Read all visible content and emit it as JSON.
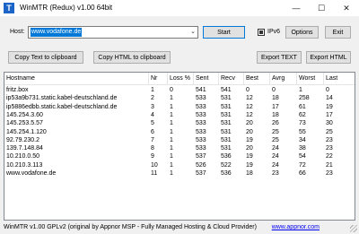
{
  "window": {
    "title": "WinMTR (Redux) v1.00 64bit",
    "icon": "winmtr-app-icon",
    "minimize": "—",
    "maximize": "☐",
    "close": "✕"
  },
  "host": {
    "label": "Host:",
    "value": "www.vodafone.de",
    "ipv6_label": "IPv6",
    "ipv6_checked": true
  },
  "buttons": {
    "start": "Start",
    "options": "Options",
    "exit": "Exit",
    "copy_text": "Copy Text to clipboard",
    "copy_html": "Copy HTML to clipboard",
    "export_text": "Export TEXT",
    "export_html": "Export HTML"
  },
  "table": {
    "headers": [
      "Hostname",
      "Nr",
      "Loss %",
      "Sent",
      "Recv",
      "Best",
      "Avrg",
      "Worst",
      "Last"
    ],
    "rows": [
      [
        "fritz.box",
        "1",
        "0",
        "541",
        "541",
        "0",
        "0",
        "1",
        "0"
      ],
      [
        "ip53a9b731.static.kabel-deutschland.de",
        "2",
        "1",
        "533",
        "531",
        "12",
        "18",
        "258",
        "14"
      ],
      [
        "ip5886edbb.static.kabel-deutschland.de",
        "3",
        "1",
        "533",
        "531",
        "12",
        "17",
        "61",
        "19"
      ],
      [
        "145.254.3.60",
        "4",
        "1",
        "533",
        "531",
        "12",
        "18",
        "62",
        "17"
      ],
      [
        "145.253.5.57",
        "5",
        "1",
        "533",
        "531",
        "20",
        "26",
        "73",
        "30"
      ],
      [
        "145.254.1.120",
        "6",
        "1",
        "533",
        "531",
        "20",
        "25",
        "55",
        "25"
      ],
      [
        "92.79.230.2",
        "7",
        "1",
        "533",
        "531",
        "19",
        "25",
        "34",
        "23"
      ],
      [
        "139.7.148.84",
        "8",
        "1",
        "533",
        "531",
        "20",
        "24",
        "38",
        "23"
      ],
      [
        "10.210.0.50",
        "9",
        "1",
        "537",
        "536",
        "19",
        "24",
        "54",
        "22"
      ],
      [
        "10.210.3.113",
        "10",
        "1",
        "526",
        "522",
        "19",
        "24",
        "72",
        "21"
      ],
      [
        "www.vodafone.de",
        "11",
        "1",
        "537",
        "536",
        "18",
        "23",
        "66",
        "23"
      ]
    ]
  },
  "status": {
    "text": "WinMTR v1.00 GPLv2 (original by Appnor MSP - Fully Managed Hosting & Cloud Provider)",
    "link": "www.appnor.com"
  }
}
